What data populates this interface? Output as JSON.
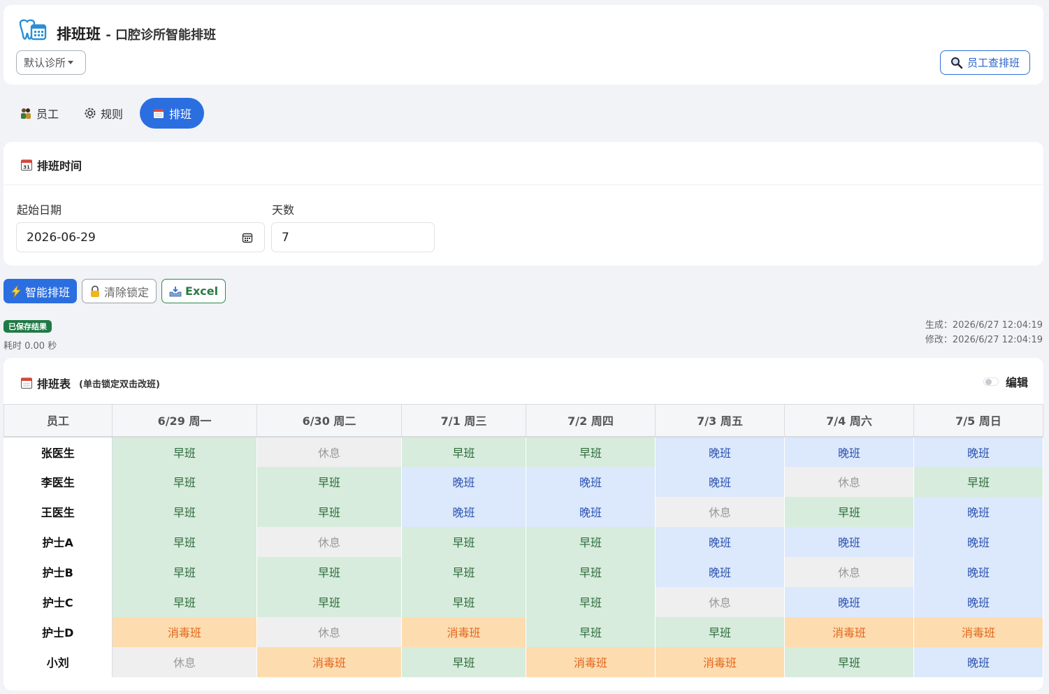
{
  "app": {
    "title": "排班班",
    "subtitle": "- 口腔诊所智能排班",
    "clinic": "默认诊所",
    "staff_lookup_label": "员工查排班"
  },
  "tabs": [
    {
      "label": "员工",
      "icon": "people-icon",
      "active": false
    },
    {
      "label": "规则",
      "icon": "gear-icon",
      "active": false
    },
    {
      "label": "排班",
      "icon": "calendar-icon",
      "active": true
    }
  ],
  "schedule_time": {
    "title": "排班时间",
    "start_date_label": "起始日期",
    "start_date_value": "2026-06-29",
    "days_label": "天数",
    "days_value": "7"
  },
  "actions": {
    "smart_schedule": "智能排班",
    "clear_locks": "清除锁定",
    "excel": "Excel"
  },
  "status": {
    "saved_badge": "已保存结果",
    "elapsed": "耗时 0.00 秒",
    "generated": "生成：2026/6/27 12:04:19",
    "modified": "修改：2026/6/27 12:04:19"
  },
  "schedule_table": {
    "title": "排班表",
    "hint": "(单击锁定双击改班)",
    "edit_label": "编辑",
    "columns": [
      "员工",
      "6/29 周一",
      "6/30 周二",
      "7/1 周三",
      "7/2 周四",
      "7/3 周五",
      "7/4 周六",
      "7/5 周日"
    ],
    "rows": [
      {
        "name": "张医生",
        "shifts": [
          "早班",
          "休息",
          "早班",
          "早班",
          "晚班",
          "晚班",
          "晚班"
        ]
      },
      {
        "name": "李医生",
        "shifts": [
          "早班",
          "早班",
          "晚班",
          "晚班",
          "晚班",
          "休息",
          "早班"
        ]
      },
      {
        "name": "王医生",
        "shifts": [
          "早班",
          "早班",
          "晚班",
          "晚班",
          "休息",
          "早班",
          "晚班"
        ]
      },
      {
        "name": "护士A",
        "shifts": [
          "早班",
          "休息",
          "早班",
          "早班",
          "晚班",
          "晚班",
          "晚班"
        ]
      },
      {
        "name": "护士B",
        "shifts": [
          "早班",
          "早班",
          "早班",
          "早班",
          "晚班",
          "休息",
          "晚班"
        ]
      },
      {
        "name": "护士C",
        "shifts": [
          "早班",
          "早班",
          "早班",
          "早班",
          "休息",
          "晚班",
          "晚班"
        ]
      },
      {
        "name": "护士D",
        "shifts": [
          "消毒班",
          "休息",
          "消毒班",
          "早班",
          "早班",
          "消毒班",
          "消毒班"
        ]
      },
      {
        "name": "小刘",
        "shifts": [
          "休息",
          "消毒班",
          "早班",
          "消毒班",
          "消毒班",
          "早班",
          "晚班"
        ]
      }
    ]
  },
  "colors": {
    "primary": "#2b6ee0",
    "early_bg": "#d7ecdc",
    "late_bg": "#dce8fb",
    "rest_bg": "#efefef",
    "disinfect_bg": "#fddcb0"
  }
}
